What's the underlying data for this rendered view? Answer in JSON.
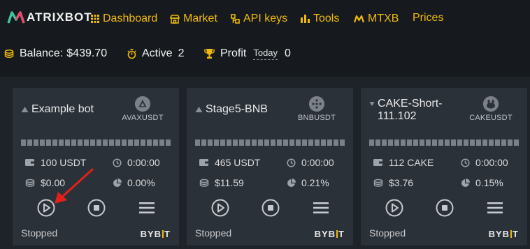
{
  "logo": {
    "text": "ATRIXBOT"
  },
  "nav": {
    "items": [
      {
        "label": "Dashboard",
        "icon": "grid-icon"
      },
      {
        "label": "Market",
        "icon": "store-icon"
      },
      {
        "label": "API keys",
        "icon": "key-icon"
      },
      {
        "label": "Tools",
        "icon": "bars-icon"
      },
      {
        "label": "MTXB",
        "icon": "mtxb-icon"
      },
      {
        "label": "Prices",
        "icon": ""
      }
    ]
  },
  "stats": {
    "balance_label": "Balance:",
    "balance_value": "$439.70",
    "active_label": "Active",
    "active_value": "2",
    "profit_label": "Profit",
    "profit_period": "Today",
    "profit_value": "0"
  },
  "colors": {
    "accent": "#f0b90b",
    "background": "#161a1e",
    "card": "#2b3139",
    "arrow": "#e0201b"
  },
  "bots": [
    {
      "title": "Example bot",
      "direction": "up",
      "pair": "AVAXUSDT",
      "coin_icon": "avax-icon",
      "amount": "100 USDT",
      "time": "0:00:00",
      "profit": "$0.00",
      "percent": "0.00%",
      "status": "Stopped",
      "exchange": "BYBIT"
    },
    {
      "title": "Stage5-BNB",
      "direction": "up",
      "pair": "BNBUSDT",
      "coin_icon": "bnb-icon",
      "amount": "465 USDT",
      "time": "0:00:00",
      "profit": "$11.59",
      "percent": "0.21%",
      "status": "Stopped",
      "exchange": "BYBIT"
    },
    {
      "title": "CAKE-Short-111.102",
      "direction": "down",
      "pair": "CAKEUSDT",
      "coin_icon": "cake-icon",
      "amount": "112 CAKE",
      "time": "0:00:00",
      "profit": "$3.76",
      "percent": "0.15%",
      "status": "Stopped",
      "exchange": "BYBIT"
    }
  ]
}
